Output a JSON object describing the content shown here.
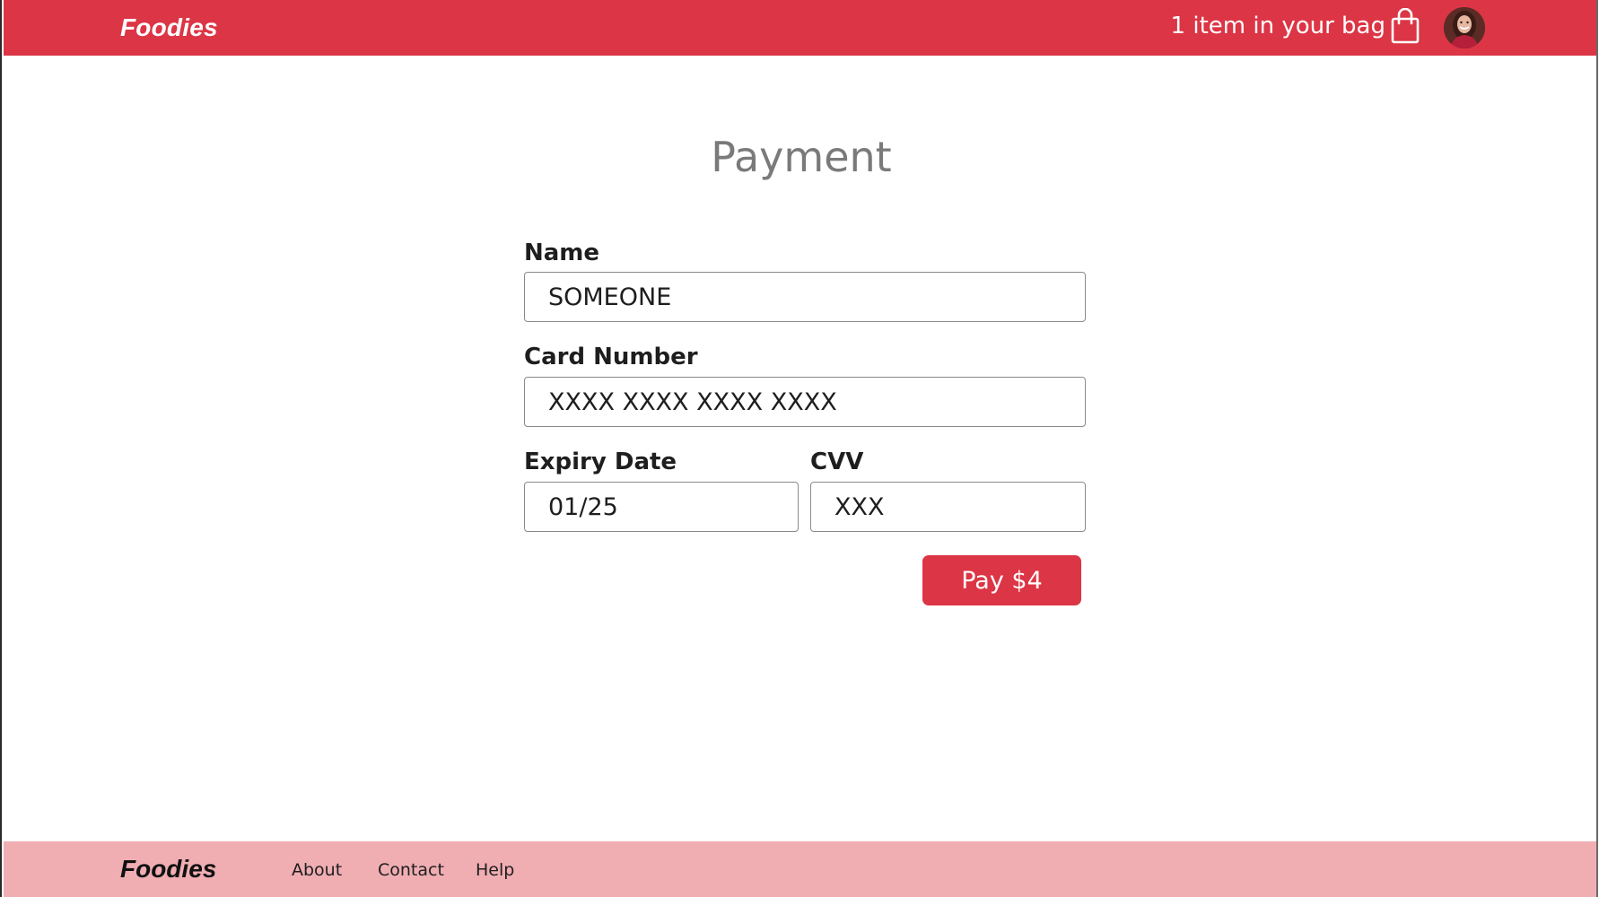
{
  "header": {
    "brand": "Foodies",
    "bag_text": "1 item in your bag",
    "bag_icon": "shopping-bag-icon",
    "avatar": "user-avatar"
  },
  "main": {
    "title": "Payment",
    "fields": {
      "name": {
        "label": "Name",
        "value": "SOMEONE"
      },
      "card_number": {
        "label": "Card Number",
        "placeholder": "XXXX XXXX XXXX XXXX"
      },
      "expiry_date": {
        "label": "Expiry Date",
        "value": "01/25"
      },
      "cvv": {
        "label": "CVV",
        "placeholder": "XXX"
      }
    },
    "pay_button": "Pay $4"
  },
  "footer": {
    "brand": "Foodies",
    "links": [
      "About",
      "Contact",
      "Help"
    ]
  },
  "colors": {
    "header_bg": "#dc3545",
    "footer_bg": "#f0aeb3",
    "button_bg": "#dc3545",
    "title_text": "#7a7a7a"
  }
}
